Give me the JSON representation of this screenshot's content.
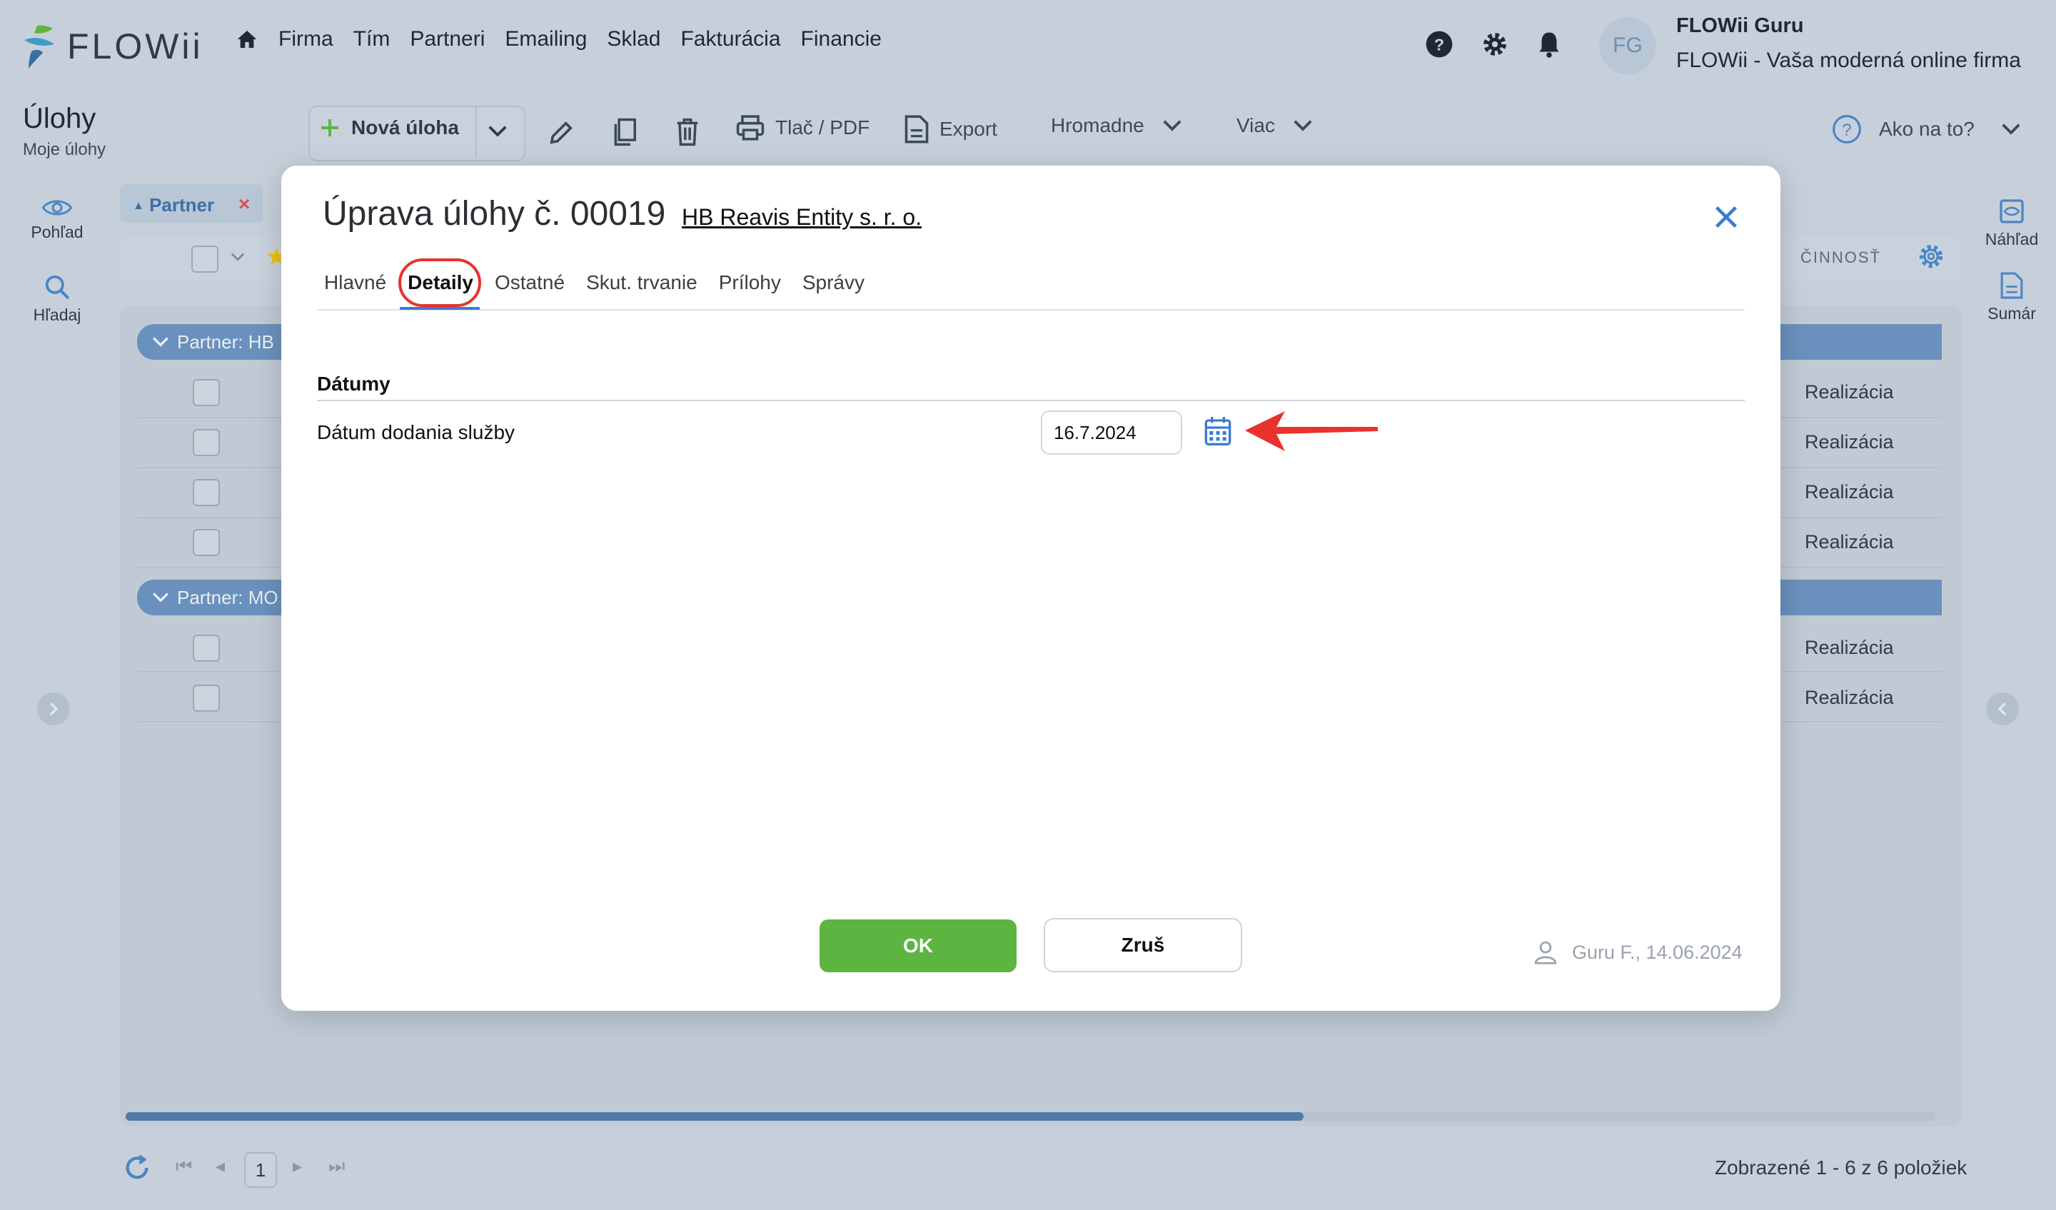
{
  "app": {
    "logo_text": "FLOWii",
    "nav": [
      "Firma",
      "Tím",
      "Partneri",
      "Emailing",
      "Sklad",
      "Fakturácia",
      "Financie"
    ],
    "user": {
      "initials": "FG",
      "name": "FLOWii Guru",
      "company": "FLOWii - Vaša moderná online firma"
    }
  },
  "page": {
    "title": "Úlohy",
    "subtitle": "Moje úlohy"
  },
  "toolbar": {
    "new_task": "Nová úloha",
    "print": "Tlač / PDF",
    "export": "Export",
    "bulk": "Hromadne",
    "more": "Viac",
    "help": "Ako na to?"
  },
  "left_panel": {
    "view": "Pohľad",
    "search": "Hľadaj"
  },
  "right_panel": {
    "preview": "Náhľad",
    "summary": "Sumár"
  },
  "grid": {
    "filter_chip": "Partner",
    "column_activity": "ČINNOSŤ",
    "groups": [
      {
        "label": "Partner: HB",
        "rows": [
          "Realizácia",
          "Realizácia",
          "Realizácia",
          "Realizácia"
        ]
      },
      {
        "label": "Partner: MO",
        "rows": [
          "Realizácia",
          "Realizácia"
        ]
      }
    ],
    "page": "1",
    "summary": "Zobrazené 1 - 6 z 6 položiek"
  },
  "modal": {
    "title": "Úprava úlohy č. 00019",
    "partner": "HB Reavis Entity s. r. o.",
    "tabs": [
      "Hlavné",
      "Detaily",
      "Ostatné",
      "Skut. trvanie",
      "Prílohy",
      "Správy"
    ],
    "active_tab": "Detaily",
    "section_title": "Dátumy",
    "field_label": "Dátum dodania služby",
    "field_value": "16.7.2024",
    "ok": "OK",
    "cancel": "Zruš",
    "footer": "Guru F., 14.06.2024"
  },
  "colors": {
    "accent": "#3d7bd0",
    "ok_green": "#5db440",
    "annotation_red": "#e8322b",
    "group_blue": "#6a91bd"
  }
}
